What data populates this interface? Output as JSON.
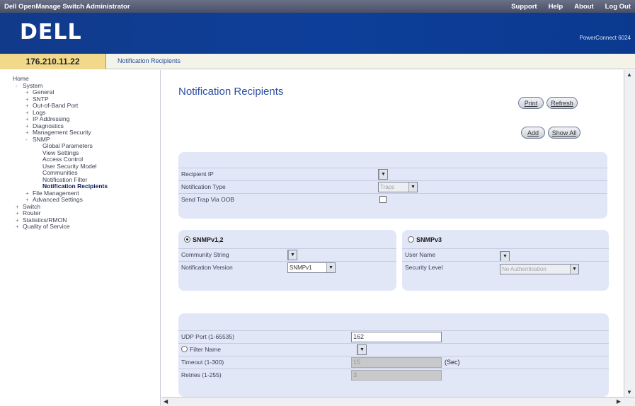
{
  "topbar": {
    "title": "Dell OpenManage Switch Administrator",
    "links": [
      "Support",
      "Help",
      "About",
      "Log Out"
    ]
  },
  "brand": {
    "logo": "DELL",
    "product": "PowerConnect 6024"
  },
  "address": {
    "ip": "176.210.11.22",
    "breadcrumb": "Notification Recipients"
  },
  "tree": [
    {
      "label": "Home",
      "exp": "",
      "indent": 0
    },
    {
      "label": "System",
      "exp": "-",
      "indent": 1
    },
    {
      "label": "General",
      "exp": "+",
      "indent": 2
    },
    {
      "label": "SNTP",
      "exp": "+",
      "indent": 2
    },
    {
      "label": "Out-of-Band Port",
      "exp": "+",
      "indent": 2
    },
    {
      "label": "Logs",
      "exp": "+",
      "indent": 2
    },
    {
      "label": "IP Addressing",
      "exp": "+",
      "indent": 2
    },
    {
      "label": "Diagnostics",
      "exp": "+",
      "indent": 2
    },
    {
      "label": "Management Security",
      "exp": "+",
      "indent": 2
    },
    {
      "label": "SNMP",
      "exp": "-",
      "indent": 2
    },
    {
      "label": "Global Parameters",
      "exp": "",
      "indent": 3
    },
    {
      "label": "View Settings",
      "exp": "",
      "indent": 3
    },
    {
      "label": "Access Control",
      "exp": "",
      "indent": 3
    },
    {
      "label": "User Security Model",
      "exp": "",
      "indent": 3
    },
    {
      "label": "Communities",
      "exp": "",
      "indent": 3
    },
    {
      "label": "Notification Filter",
      "exp": "",
      "indent": 3
    },
    {
      "label": "Notification Recipients",
      "exp": "",
      "indent": 3,
      "selected": true
    },
    {
      "label": "File Management",
      "exp": "+",
      "indent": 2
    },
    {
      "label": "Advanced Settings",
      "exp": "+",
      "indent": 2
    },
    {
      "label": "Switch",
      "exp": "+",
      "indent": 1
    },
    {
      "label": "Router",
      "exp": "+",
      "indent": 1
    },
    {
      "label": "Statistics/RMON",
      "exp": "+",
      "indent": 1
    },
    {
      "label": "Quality of Service",
      "exp": "+",
      "indent": 1
    }
  ],
  "main": {
    "title": "Notification Recipients",
    "buttons": {
      "print": "Print",
      "refresh": "Refresh",
      "add": "Add",
      "show_all": "Show All"
    },
    "general": {
      "recipient_ip_label": "Recipient IP",
      "recipient_ip_value": "",
      "notification_type_label": "Notification Type",
      "notification_type_value": "Traps",
      "send_trap_label": "Send Trap Via OOB",
      "send_trap_checked": false
    },
    "snmpv12": {
      "title": "SNMPv1,2",
      "selected": true,
      "community_label": "Community String",
      "community_value": "",
      "version_label": "Notification Version",
      "version_value": "SNMPv1"
    },
    "snmpv3": {
      "title": "SNMPv3",
      "selected": false,
      "user_label": "User Name",
      "user_value": "",
      "security_label": "Security Level",
      "security_value": "No Authentication"
    },
    "udp": {
      "port_label": "UDP Port (1-65535)",
      "port_value": "162",
      "filter_label": "Filter Name",
      "filter_value": "",
      "timeout_label": "Timeout (1-300)",
      "timeout_value": "15",
      "timeout_unit": "(Sec)",
      "retries_label": "Retries (1-255)",
      "retries_value": "3"
    }
  }
}
